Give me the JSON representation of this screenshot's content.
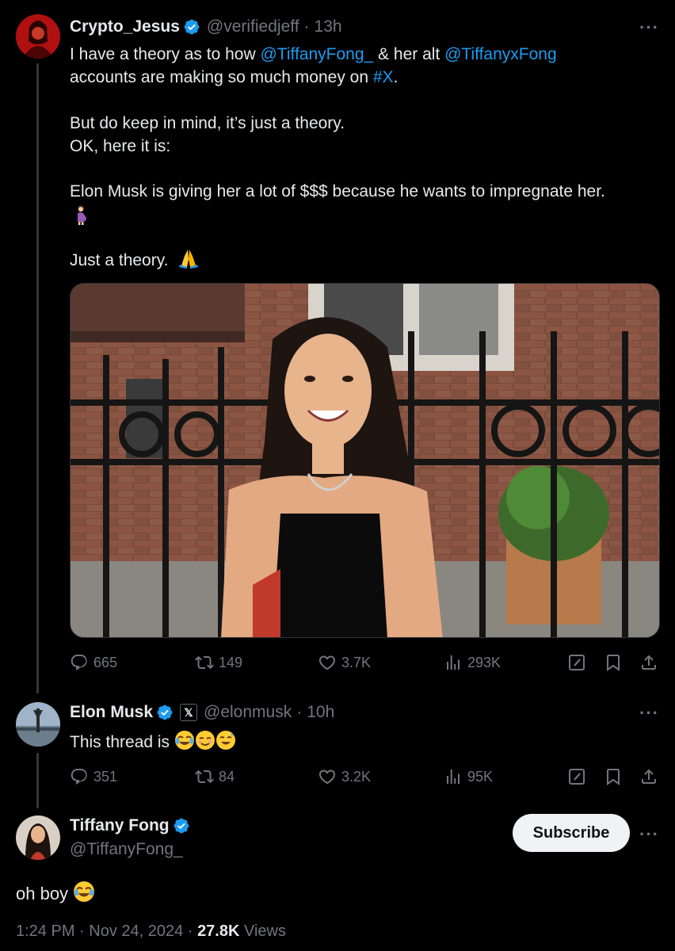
{
  "tweet1": {
    "display_name": "Crypto_Jesus",
    "handle": "@verifiedjeff",
    "sep": "·",
    "time": "13h",
    "more": "···",
    "line1_pre": "I have a theory as to how ",
    "line1_mention1": "@TiffanyFong_",
    "line1_mid": " & her alt ",
    "line1_mention2": "@TiffanyxFong",
    "line2_pre": "accounts are making so much money on ",
    "line2_hashtag": "#X",
    "line2_post": ".",
    "line3": "But do keep in mind, it’s just a theory.",
    "line4": "OK, here it is:",
    "line5": "Elon Musk is giving her a lot of $$$ because he wants to impregnate her.",
    "line6_emoji": "pregnant-person-emoji",
    "line7": "Just a theory.",
    "line7_emoji": "folded-hands-emoji",
    "replies": "665",
    "reposts": "149",
    "likes": "3.7K",
    "views": "293K"
  },
  "tweet2": {
    "display_name": "Elon Musk",
    "affiliate_badge": "𝕏",
    "handle": "@elonmusk",
    "sep": "·",
    "time": "10h",
    "more": "···",
    "text": "This thread is",
    "emojis": [
      "face-with-tears-of-joy-emoji",
      "smiling-face-emoji",
      "grinning-sweat-emoji"
    ],
    "replies": "351",
    "reposts": "84",
    "likes": "3.2K",
    "views": "95K"
  },
  "tweet3": {
    "display_name": "Tiffany Fong",
    "handle": "@TiffanyFong_",
    "subscribe_label": "Subscribe",
    "more": "···",
    "text": "oh boy",
    "emoji": "face-with-tears-of-joy-emoji",
    "time": "1:24 PM",
    "sep1": "·",
    "date": "Nov 24, 2024",
    "sep2": "·",
    "views_count": "27.8K",
    "views_label": "Views"
  },
  "colors": {
    "background": "#000000",
    "text": "#e7e9ea",
    "muted": "#71767b",
    "link": "#1d9bf0",
    "verified": "#1d9bf0"
  }
}
